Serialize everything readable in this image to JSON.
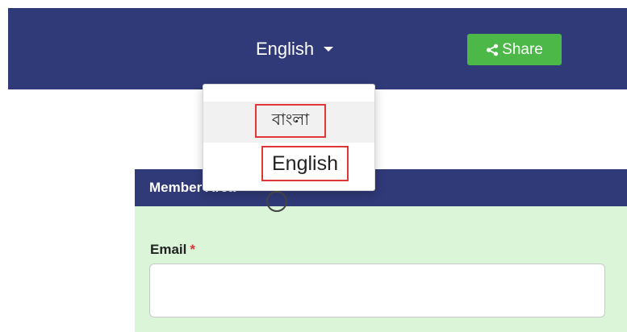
{
  "header": {
    "language_selector": {
      "current": "English"
    },
    "share_button": {
      "label": "Share",
      "icon": "share-icon"
    }
  },
  "language_dropdown": {
    "items": [
      {
        "label": "বাংলা"
      },
      {
        "label": "English"
      }
    ]
  },
  "panel": {
    "title": "Member Area",
    "email_field": {
      "label": "Email",
      "required_marker": "*",
      "value": "",
      "placeholder": ""
    }
  },
  "colors": {
    "header_bg": "#303a78",
    "share_green": "#4cb848",
    "panel_bg": "#dbf5d9",
    "highlight_red": "#e03636"
  }
}
